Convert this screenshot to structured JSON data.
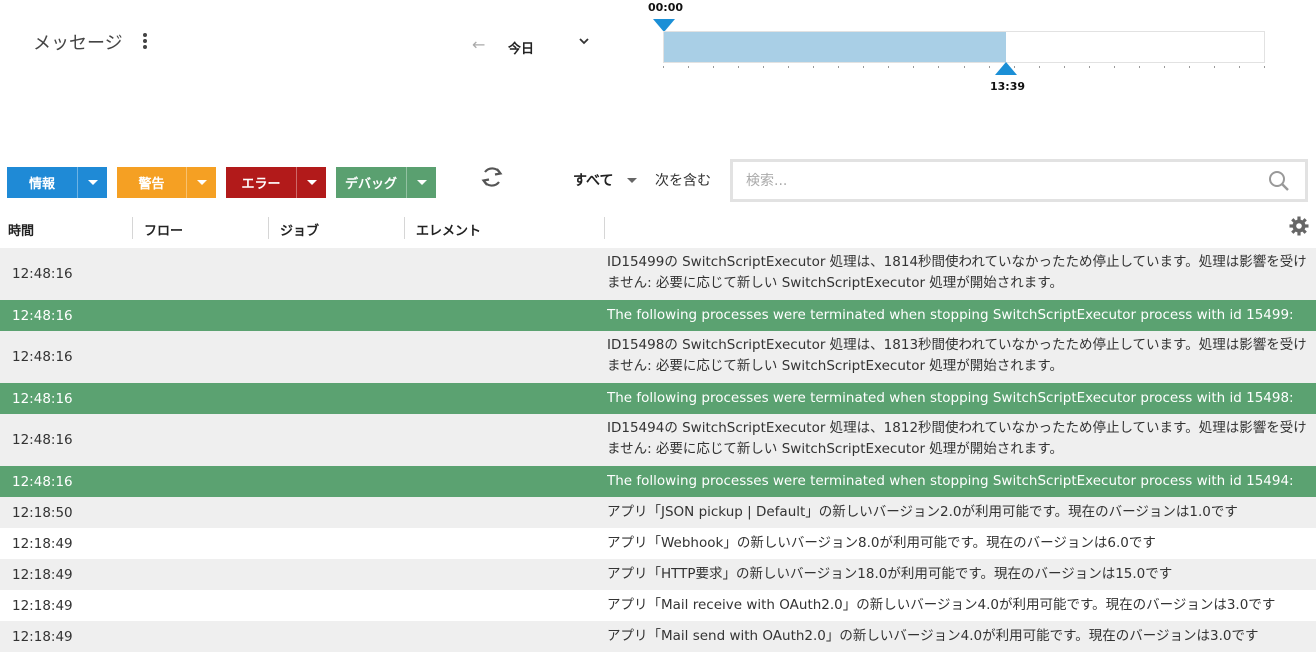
{
  "header": {
    "title": "メッセージ",
    "more_icon": "kebab-vertical-icon",
    "back_icon": "arrow-left-icon",
    "period": "今日",
    "period_icon": "chevron-down-icon"
  },
  "timeline": {
    "start_label": "00:00",
    "end_label": "13:39",
    "filled_fraction": 0.57,
    "fill_color": "#a9cfe6",
    "marker_color": "#1b8fd6"
  },
  "toolbar": {
    "filters": [
      {
        "label": "情報",
        "color": "#1f8ad6"
      },
      {
        "label": "警告",
        "color": "#f5a023"
      },
      {
        "label": "エラー",
        "color": "#b21a1a"
      },
      {
        "label": "デバッグ",
        "color": "#5aa070"
      }
    ],
    "refresh_icon": "refresh-icon",
    "scope": "すべて",
    "contains": "次を含む",
    "search_placeholder": "検索...",
    "search_icon": "search-icon"
  },
  "table": {
    "columns": [
      "時間",
      "フロー",
      "ジョブ",
      "エレメント"
    ],
    "settings_icon": "gear-icon",
    "highlight_color": "#5ba271",
    "rows": [
      {
        "time": "12:48:16",
        "msg1": "ID15499の SwitchScriptExecutor 処理は、1814秒間使われていなかったため停止しています。処理は影響を受け",
        "msg2": "ません: 必要に応じて新しい SwitchScriptExecutor 処理が開始されます。",
        "type": "odd"
      },
      {
        "time": "12:48:16",
        "msg1": "The following processes were terminated when stopping SwitchScriptExecutor process with id 15499:",
        "msg2": "",
        "type": "hl"
      },
      {
        "time": "12:48:16",
        "msg1": "ID15498の SwitchScriptExecutor 処理は、1813秒間使われていなかったため停止しています。処理は影響を受け",
        "msg2": "ません: 必要に応じて新しい SwitchScriptExecutor 処理が開始されます。",
        "type": "odd"
      },
      {
        "time": "12:48:16",
        "msg1": "The following processes were terminated when stopping SwitchScriptExecutor process with id 15498:",
        "msg2": "",
        "type": "hl"
      },
      {
        "time": "12:48:16",
        "msg1": "ID15494の SwitchScriptExecutor 処理は、1812秒間使われていなかったため停止しています。処理は影響を受け",
        "msg2": "ません: 必要に応じて新しい SwitchScriptExecutor 処理が開始されます。",
        "type": "odd"
      },
      {
        "time": "12:48:16",
        "msg1": "The following processes were terminated when stopping SwitchScriptExecutor process with id 15494:",
        "msg2": "",
        "type": "hl"
      },
      {
        "time": "12:18:50",
        "msg1": "アプリ「JSON pickup | Default」の新しいバージョン2.0が利用可能です。現在のバージョンは1.0です",
        "msg2": "",
        "type": "odd"
      },
      {
        "time": "12:18:49",
        "msg1": "アプリ「Webhook」の新しいバージョン8.0が利用可能です。現在のバージョンは6.0です",
        "msg2": "",
        "type": "even"
      },
      {
        "time": "12:18:49",
        "msg1": "アプリ「HTTP要求」の新しいバージョン18.0が利用可能です。現在のバージョンは15.0です",
        "msg2": "",
        "type": "odd"
      },
      {
        "time": "12:18:49",
        "msg1": "アプリ「Mail receive with OAuth2.0」の新しいバージョン4.0が利用可能です。現在のバージョンは3.0です",
        "msg2": "",
        "type": "even"
      },
      {
        "time": "12:18:49",
        "msg1": "アプリ「Mail send with OAuth2.0」の新しいバージョン4.0が利用可能です。現在のバージョンは3.0です",
        "msg2": "",
        "type": "odd"
      }
    ]
  }
}
